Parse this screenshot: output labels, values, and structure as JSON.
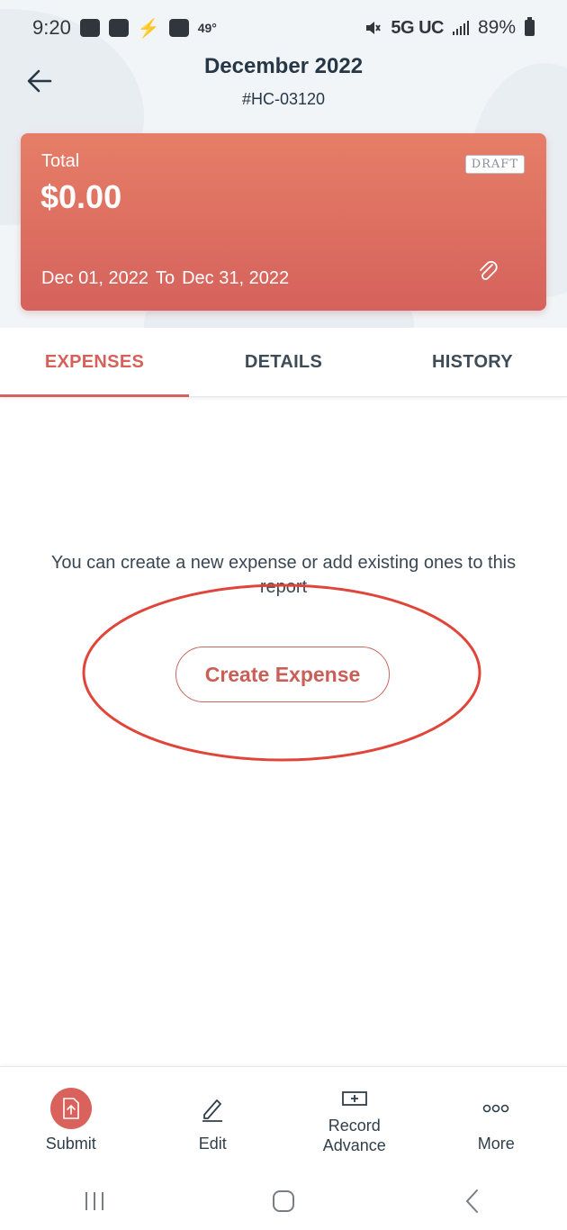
{
  "status_bar": {
    "time": "9:20",
    "temperature": "49°",
    "network": "5G UC",
    "battery": "89%"
  },
  "header": {
    "title": "December 2022",
    "report_id": "#HC-03120"
  },
  "report_card": {
    "total_label": "Total",
    "total_value": "$0.00",
    "status_badge": "DRAFT",
    "start_date": "Dec 01, 2022",
    "date_separator": "To",
    "end_date": "Dec 31, 2022"
  },
  "tabs": [
    {
      "label": "EXPENSES",
      "active": true
    },
    {
      "label": "DETAILS",
      "active": false
    },
    {
      "label": "HISTORY",
      "active": false
    }
  ],
  "empty_state": {
    "message": "You can create a new expense or add existing ones to this report",
    "button_label": "Create Expense"
  },
  "actions": [
    {
      "label": "Submit",
      "icon": "submit-icon"
    },
    {
      "label": "Edit",
      "icon": "pencil-icon"
    },
    {
      "label": "Record Advance",
      "icon": "money-icon"
    },
    {
      "label": "More",
      "icon": "more-icon"
    }
  ],
  "colors": {
    "accent": "#d6605a",
    "card_top": "#e67e67",
    "card_bottom": "#d5625c",
    "highlight_ellipse": "#e0453a"
  }
}
